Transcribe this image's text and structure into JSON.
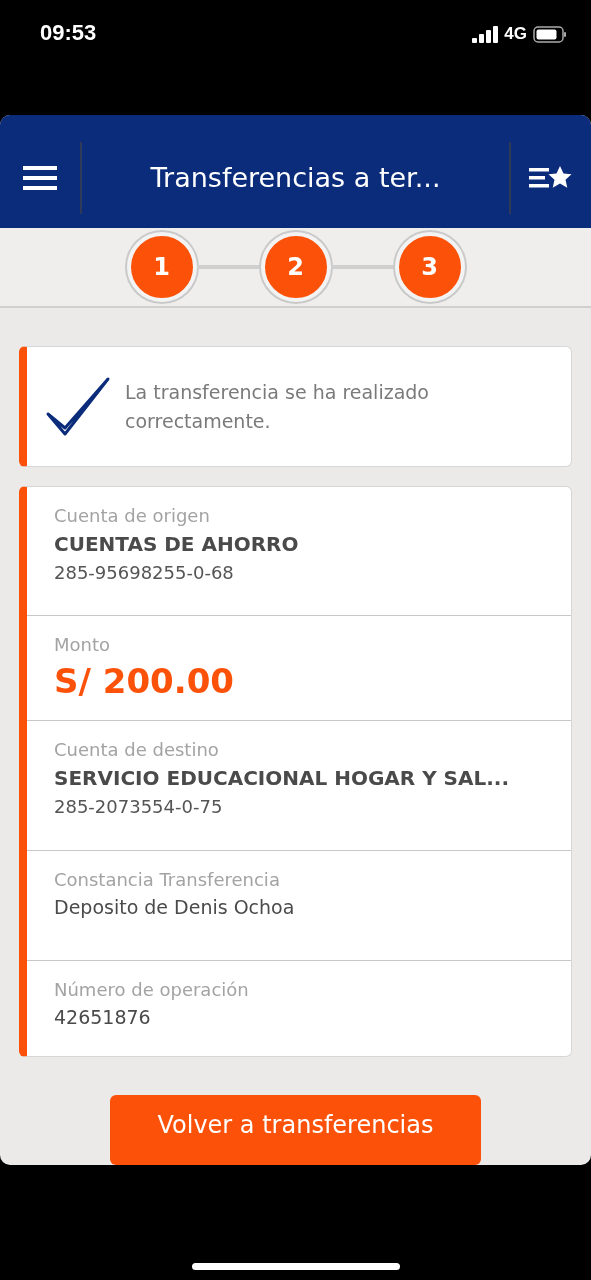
{
  "status_bar": {
    "time": "09:53",
    "network": "4G"
  },
  "header": {
    "title": "Transferencias a ter..."
  },
  "steps": [
    {
      "label": "1"
    },
    {
      "label": "2"
    },
    {
      "label": "3"
    }
  ],
  "success": {
    "message": "La transferencia se ha realizado correctamente."
  },
  "details": [
    {
      "label": "Cuenta de origen",
      "value": "CUENTAS DE AHORRO",
      "kind": "bold",
      "sub": "285-95698255-0-68"
    },
    {
      "label": "Monto",
      "value": "S/ 200.00",
      "kind": "amount"
    },
    {
      "label": "Cuenta de destino",
      "value": "SERVICIO EDUCACIONAL HOGAR Y SAL...",
      "kind": "bold",
      "sub": "285-2073554-0-75"
    },
    {
      "label": "Constancia Transferencia",
      "value": "Deposito de Denis Ochoa",
      "kind": "plain"
    },
    {
      "label": "Número de operación",
      "value": "42651876",
      "kind": "plain"
    }
  ],
  "button": {
    "label": "Volver a transferencias"
  }
}
